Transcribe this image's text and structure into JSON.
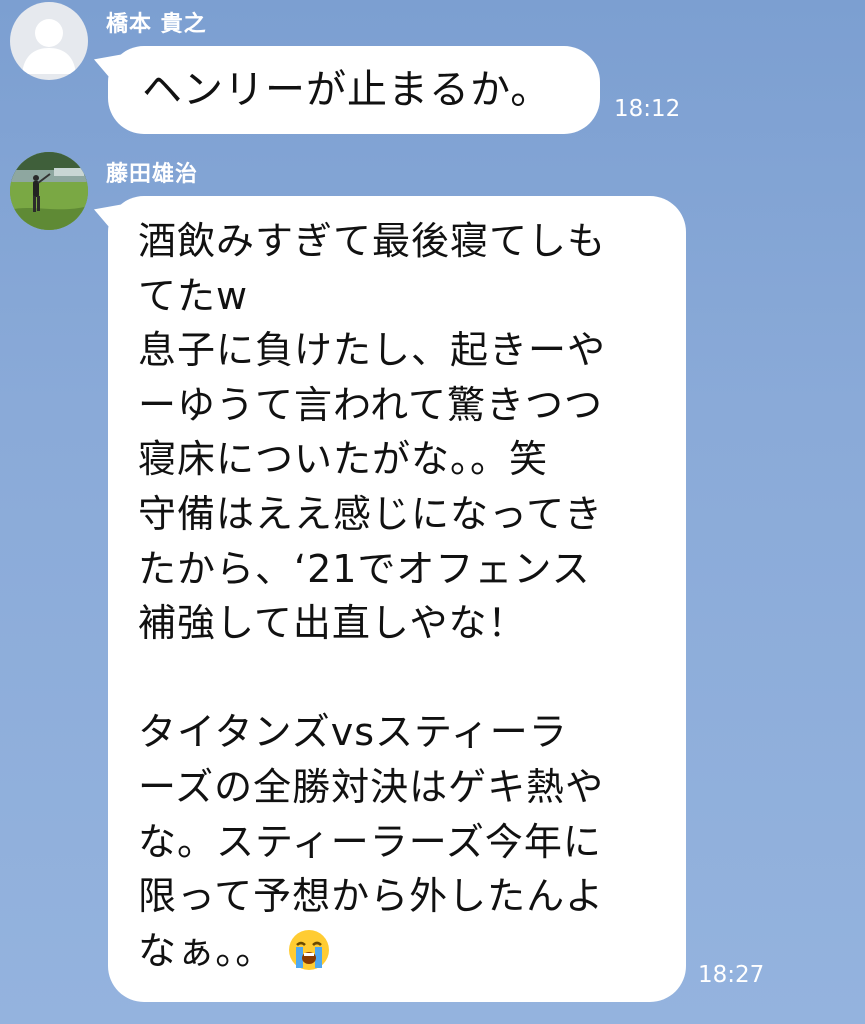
{
  "messages": [
    {
      "sender": "橋本 貴之",
      "text": "ヘンリーが止まるか。",
      "time": "18:12",
      "avatar": "default-person-icon"
    },
    {
      "sender": "藤田雄治",
      "text": "酒飲みすぎて最後寝てしも\nてたw\n息子に負けたし、起きーや\nーゆうて言われて驚きつつ\n寝床についたがな。。笑\n守備はええ感じになってき\nたから、‘21でオフェンス\n補強して出直しやな！\n\nタイタンズvsスティーラ\nーズの全勝対決はゲキ熱や\nな。スティーラーズ今年に\n限って予想から外したんよ\nなぁ。。",
      "emoji": "loudly-crying-face-icon",
      "time": "18:27",
      "avatar": "golfer-photo"
    }
  ],
  "colors": {
    "background": "#8aaad8",
    "bubble": "#ffffff",
    "text": "#111111",
    "meta_text": "#ffffff"
  }
}
